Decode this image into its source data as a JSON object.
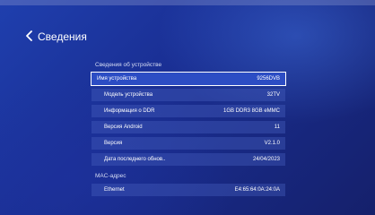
{
  "header": {
    "back_label": "Сведения"
  },
  "device_section": {
    "title": "Сведения об устройстве",
    "rows": [
      {
        "label": "Имя устройства",
        "value": "9256DVB"
      },
      {
        "label": "Модель устройства",
        "value": "32TV"
      },
      {
        "label": "Информация о DDR",
        "value": "1GB DDR3 8GB eMMC"
      },
      {
        "label": "Версия Android",
        "value": "11"
      },
      {
        "label": "Версия",
        "value": "V2.1.0"
      },
      {
        "label": "Дата последнего обнов..",
        "value": "24/04/2023"
      }
    ]
  },
  "mac_section": {
    "title": "MAC-адрес",
    "rows": [
      {
        "label": "Ethernet",
        "value": "E4:65:64:0A:24:0A"
      }
    ]
  },
  "icons": {
    "back": "chevron-left-icon"
  }
}
